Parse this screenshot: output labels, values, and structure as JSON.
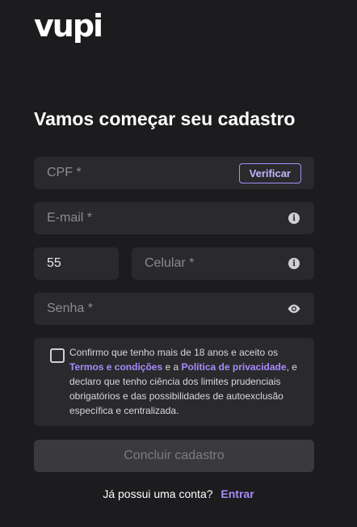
{
  "brand": {
    "logo_text": "vupi"
  },
  "form": {
    "title": "Vamos começar seu cadastro",
    "cpf": {
      "placeholder": "CPF *",
      "verify_label": "Verificar"
    },
    "email": {
      "placeholder": "E-mail *"
    },
    "phone": {
      "country_code": "55",
      "placeholder": "Celular *"
    },
    "password": {
      "placeholder": "Senha *"
    },
    "consent": {
      "text_1": "Confirmo que tenho mais de 18 anos e aceito os",
      "terms_link": "Termos e condições",
      "text_2": " e a ",
      "privacy_link": "Política de privacidade",
      "text_3": ", e declaro que tenho ciência dos limites prudenciais obrigatórios e das possibilidades de autoexclusão específica e centralizada."
    },
    "submit_label": "Concluir cadastro"
  },
  "footer": {
    "question": "Já possui uma conta?",
    "login_link": "Entrar"
  },
  "colors": {
    "background": "#1c1c1e",
    "field": "#2a2a2d",
    "accent": "#a78bfa"
  }
}
